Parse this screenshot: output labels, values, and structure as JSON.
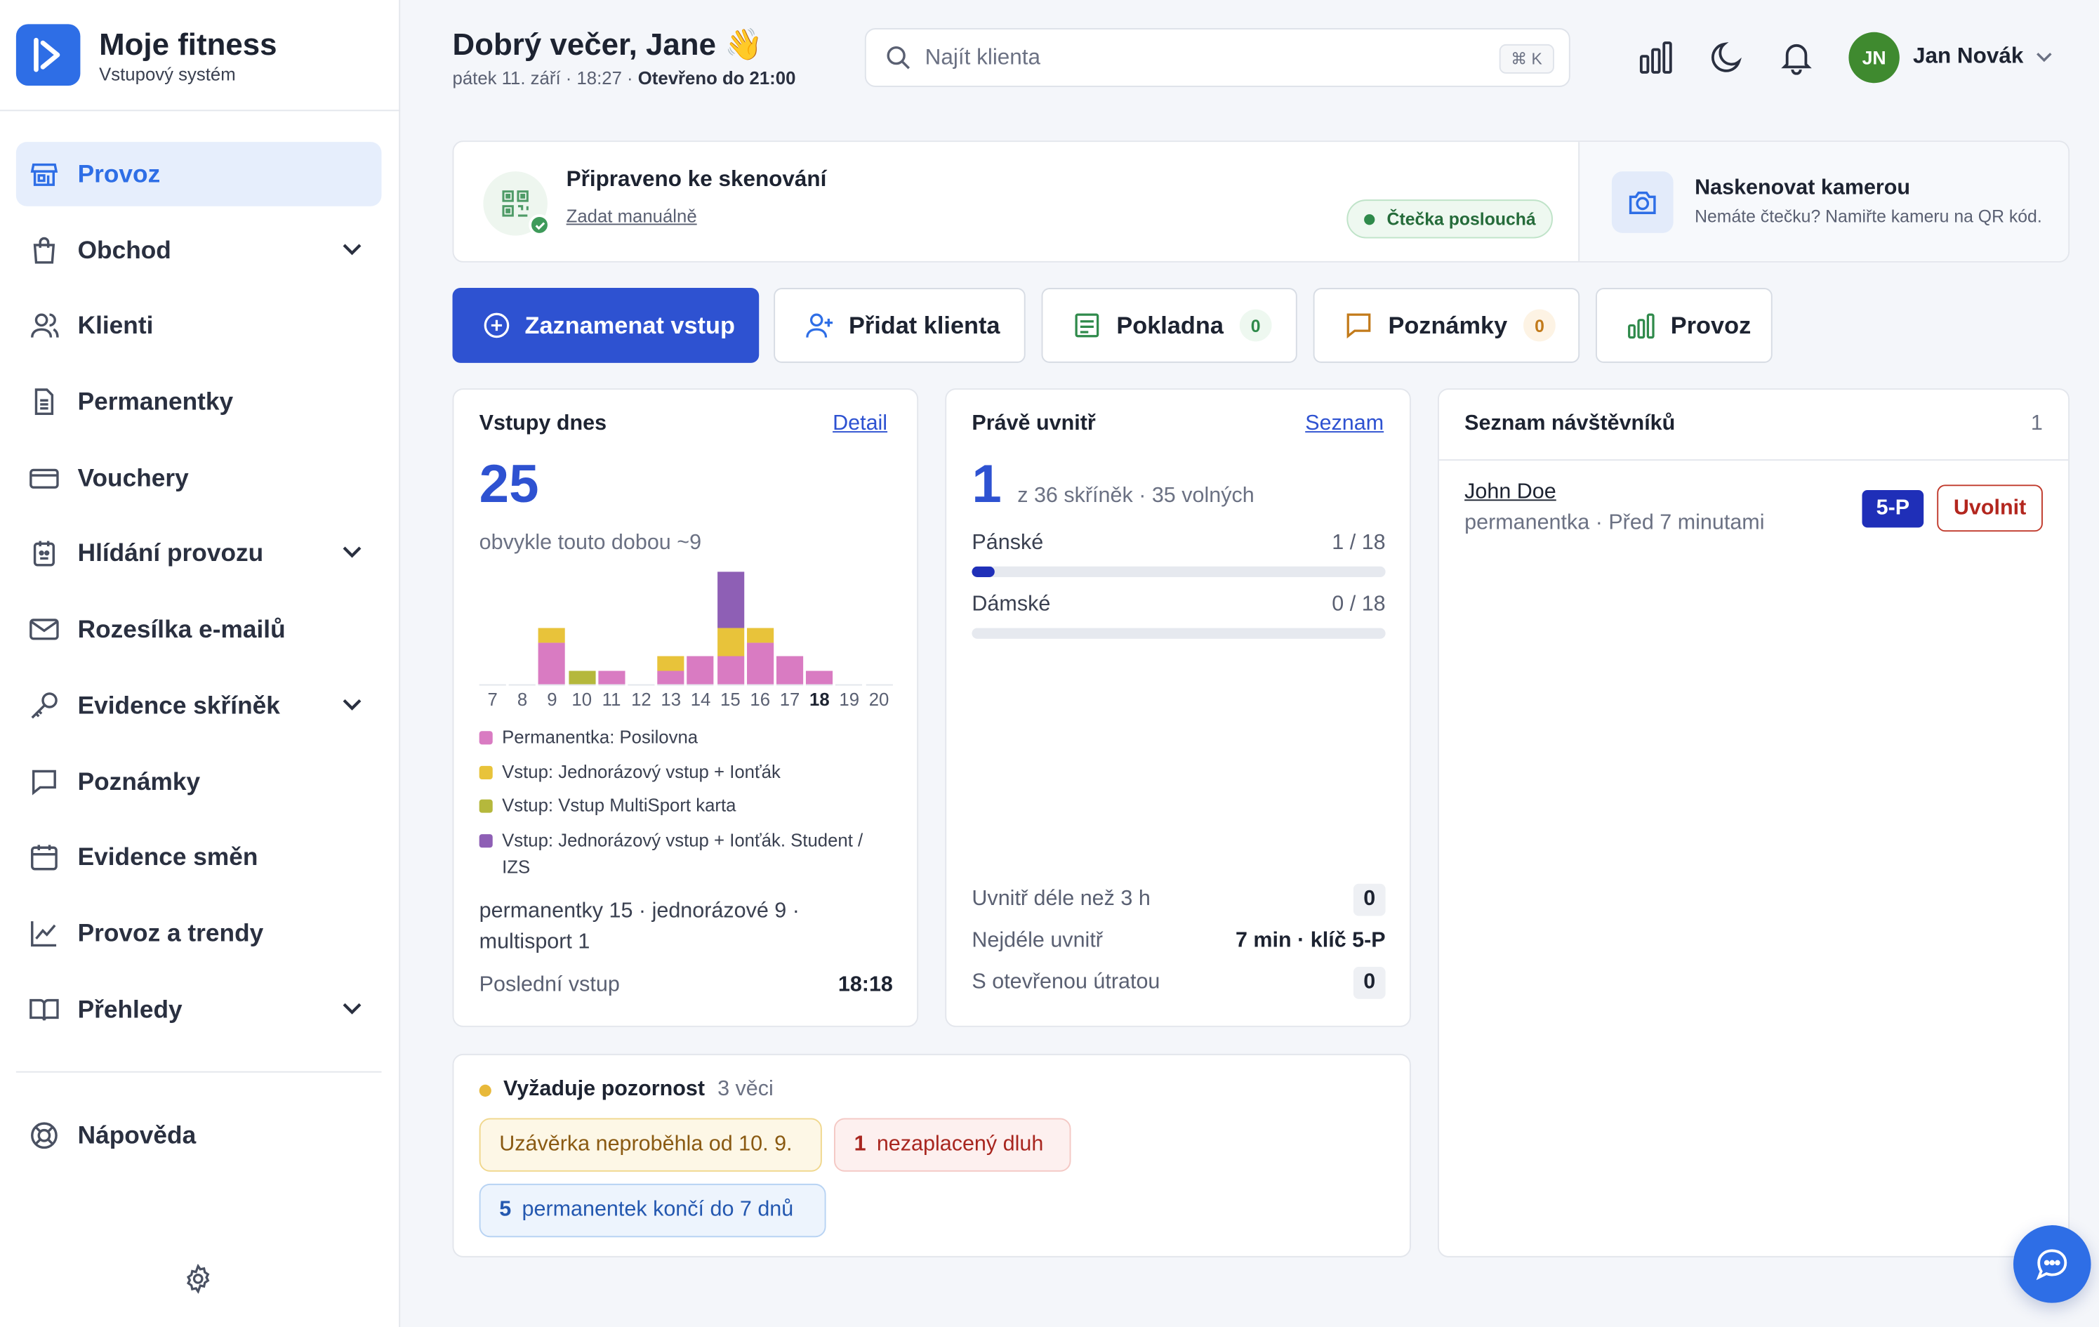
{
  "brand": {
    "title": "Moje fitness",
    "subtitle": "Vstupový systém"
  },
  "sidebar": {
    "items": [
      {
        "label": "Provoz",
        "icon": "store-icon",
        "active": true,
        "expandable": false
      },
      {
        "label": "Obchod",
        "icon": "shopping-bag-icon",
        "expandable": true
      },
      {
        "label": "Klienti",
        "icon": "users-icon",
        "expandable": false
      },
      {
        "label": "Permanentky",
        "icon": "document-icon",
        "expandable": false
      },
      {
        "label": "Vouchery",
        "icon": "card-icon",
        "expandable": false
      },
      {
        "label": "Hlídání provozu",
        "icon": "monitor-icon",
        "expandable": true
      },
      {
        "label": "Rozesílka e-mailů",
        "icon": "mail-icon",
        "expandable": false
      },
      {
        "label": "Evidence skříněk",
        "icon": "key-icon",
        "expandable": true
      },
      {
        "label": "Poznámky",
        "icon": "comment-icon",
        "expandable": false
      },
      {
        "label": "Evidence směn",
        "icon": "calendar-icon",
        "expandable": false
      },
      {
        "label": "Provoz a trendy",
        "icon": "trend-chart-icon",
        "expandable": false
      },
      {
        "label": "Přehledy",
        "icon": "book-icon",
        "expandable": true
      }
    ],
    "help": "Nápověda"
  },
  "header": {
    "greeting": "Dobrý večer, Jane 👋",
    "date_text": "pátek 11. září · 18:27 · ",
    "open_text": "Otevřeno do 21:00",
    "search_placeholder": "Najít klienta",
    "search_shortcut": "⌘ K",
    "user_initials": "JN",
    "user_name": "Jan Novák"
  },
  "scan": {
    "title": "Připraveno ke skenování",
    "manual_link": "Zadat manuálně",
    "status": "Čtečka poslouchá",
    "camera_title": "Naskenovat kamerou",
    "camera_sub": "Nemáte čtečku? Namiřte kameru na QR kód."
  },
  "actions": {
    "record_entry": "Zaznamenat vstup",
    "add_client": "Přidat klienta",
    "register": "Pokladna",
    "register_count": "0",
    "notes": "Poznámky",
    "notes_count": "0",
    "operations": "Provoz"
  },
  "entries_today": {
    "title": "Vstupy dnes",
    "link": "Detail",
    "count": "25",
    "usual": "obvykle touto dobou ~9",
    "summary": "permanentky 15 · jednorázové 9 · multisport 1",
    "last_entry_label": "Poslední vstup",
    "last_entry_time": "18:18"
  },
  "chart_data": {
    "type": "bar",
    "stacked": true,
    "categories": [
      "7",
      "8",
      "9",
      "10",
      "11",
      "12",
      "13",
      "14",
      "15",
      "16",
      "17",
      "18",
      "19",
      "20"
    ],
    "current_category": "18",
    "series": [
      {
        "name": "Permanentka: Posilovna",
        "color": "#d97bc2",
        "values": [
          0,
          0,
          3,
          0,
          1,
          0,
          1,
          2,
          2,
          3,
          2,
          1,
          0,
          0
        ]
      },
      {
        "name": "Vstup: Jednorázový vstup + Ionťák",
        "color": "#e8c33a",
        "values": [
          0,
          0,
          1,
          0,
          0,
          0,
          1,
          0,
          2,
          1,
          0,
          0,
          0,
          0
        ]
      },
      {
        "name": "Vstup: Vstup MultiSport karta",
        "color": "#b5b83c",
        "values": [
          0,
          0,
          0,
          1,
          0,
          0,
          0,
          0,
          0,
          0,
          0,
          0,
          0,
          0
        ]
      },
      {
        "name": "Vstup: Jednorázový vstup + Ionťák. Student / IZS",
        "color": "#8e5fb5",
        "values": [
          0,
          0,
          0,
          0,
          0,
          0,
          0,
          0,
          4,
          0,
          0,
          0,
          0,
          0
        ]
      }
    ]
  },
  "inside": {
    "title": "Právě uvnitř",
    "link": "Seznam",
    "count": "1",
    "lockers_text": "z 36 skříněk · 35 volných",
    "men_label": "Pánské",
    "men_value": "1 / 18",
    "men_fraction": 0.0556,
    "women_label": "Dámské",
    "women_value": "0 / 18",
    "women_fraction": 0,
    "longer3h_label": "Uvnitř déle než 3 h",
    "longer3h_value": "0",
    "longest_label": "Nejdéle uvnitř",
    "longest_value": "7 min · klíč 5-P",
    "open_tab_label": "S otevřenou útratou",
    "open_tab_value": "0"
  },
  "visitors": {
    "title": "Seznam návštěvníků",
    "count": "1",
    "list": [
      {
        "name": "John Doe",
        "detail": "permanentka · Před 7 minutami",
        "locker": "5-P",
        "action": "Uvolnit"
      }
    ]
  },
  "attention": {
    "title": "Vyžaduje pozornost",
    "count_text": "3 věci",
    "pill_closing": "Uzávěrka neproběhla od 10. 9.",
    "pill_debt_num": "1",
    "pill_debt_text": "nezaplacený dluh",
    "pill_passes_num": "5",
    "pill_passes_text": "permanentek končí do 7 dnů"
  },
  "colors": {
    "accent": "#2e52d1",
    "brand": "#2e6ee6",
    "success": "#2f8a4b",
    "danger": "#b3261e"
  }
}
